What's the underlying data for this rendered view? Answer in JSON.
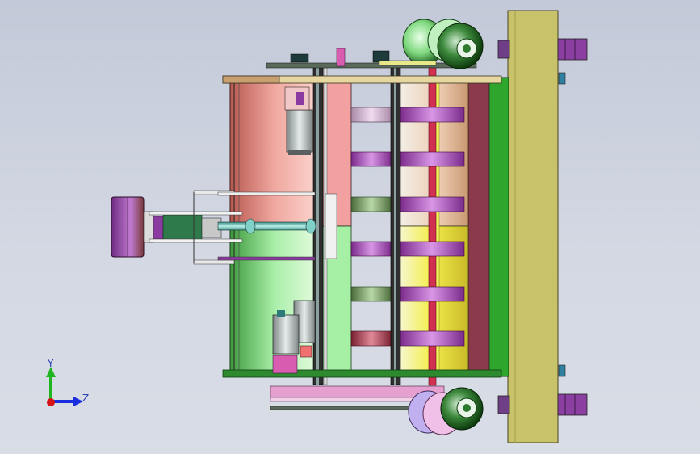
{
  "viewport": {
    "background_top": "#c3c9d8",
    "background_bottom": "#d9dde6"
  },
  "triad": {
    "y_label": "Y",
    "z_label": "Z",
    "y_color": "#1fb51f",
    "z_color": "#1a2ee0",
    "x_color": "#d41414"
  },
  "colors": {
    "plate_olive": "#c8c26a",
    "roller_pink": "#ec8e8e",
    "roller_green": "#a6f0a6",
    "yellow_drum": "#f4f25a",
    "magenta_disc": "#b25ec8",
    "motor_grey": "#b9c1c1",
    "wheel_green": "#2d7a2d"
  }
}
